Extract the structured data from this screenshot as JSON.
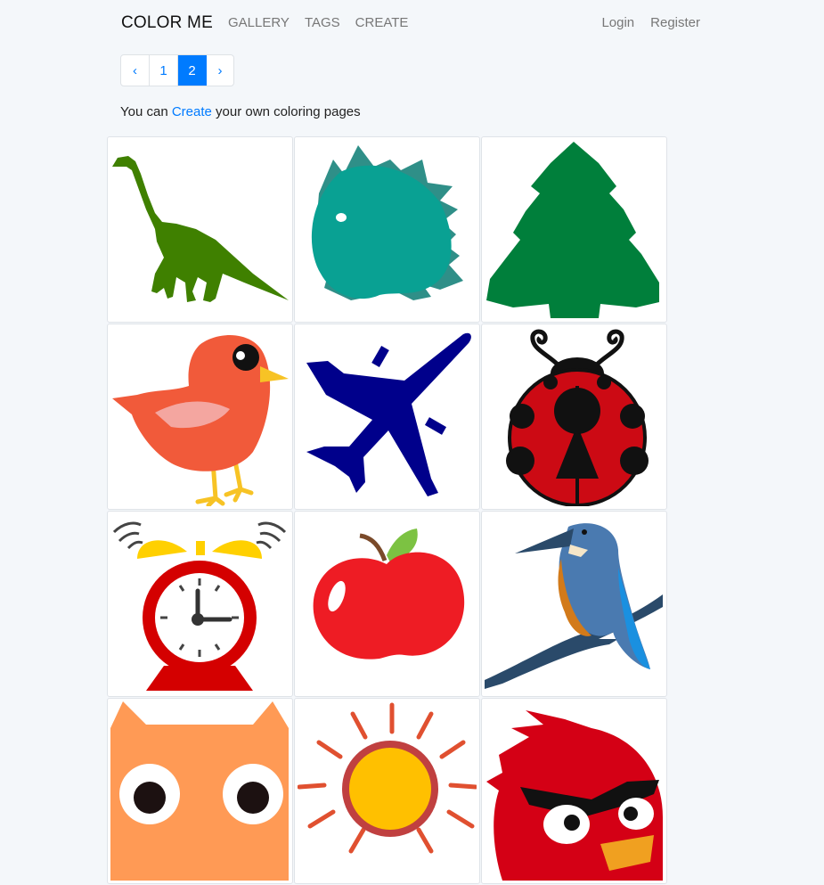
{
  "nav": {
    "brand": "COLOR ME",
    "links": [
      "GALLERY",
      "TAGS",
      "CREATE"
    ],
    "auth": [
      "Login",
      "Register"
    ]
  },
  "pagination": {
    "prev": "‹",
    "pages": [
      "1",
      "2"
    ],
    "current": "2",
    "next": "›"
  },
  "intro": {
    "prefix": "You can ",
    "link": "Create",
    "suffix": " your own coloring pages"
  },
  "gallery": {
    "items": [
      {
        "icon": "dinosaur-icon",
        "color": "#3f8000"
      },
      {
        "icon": "stegosaurus-icon",
        "color": "#07998d"
      },
      {
        "icon": "pine-tree-icon",
        "color": "#007f3b"
      },
      {
        "icon": "bird-icon",
        "color": "#f15a3a"
      },
      {
        "icon": "airplane-icon",
        "color": "#00008b"
      },
      {
        "icon": "ladybug-icon",
        "color": "#cc0a14"
      },
      {
        "icon": "alarm-clock-icon",
        "color": "#d40000"
      },
      {
        "icon": "apple-icon",
        "color": "#ee1c24"
      },
      {
        "icon": "kingfisher-icon",
        "color": "#2e5fa6"
      },
      {
        "icon": "owl-icon",
        "color": "#ff9a55"
      },
      {
        "icon": "sun-icon",
        "color": "#ffc000"
      },
      {
        "icon": "angry-bird-icon",
        "color": "#d40015"
      }
    ]
  }
}
